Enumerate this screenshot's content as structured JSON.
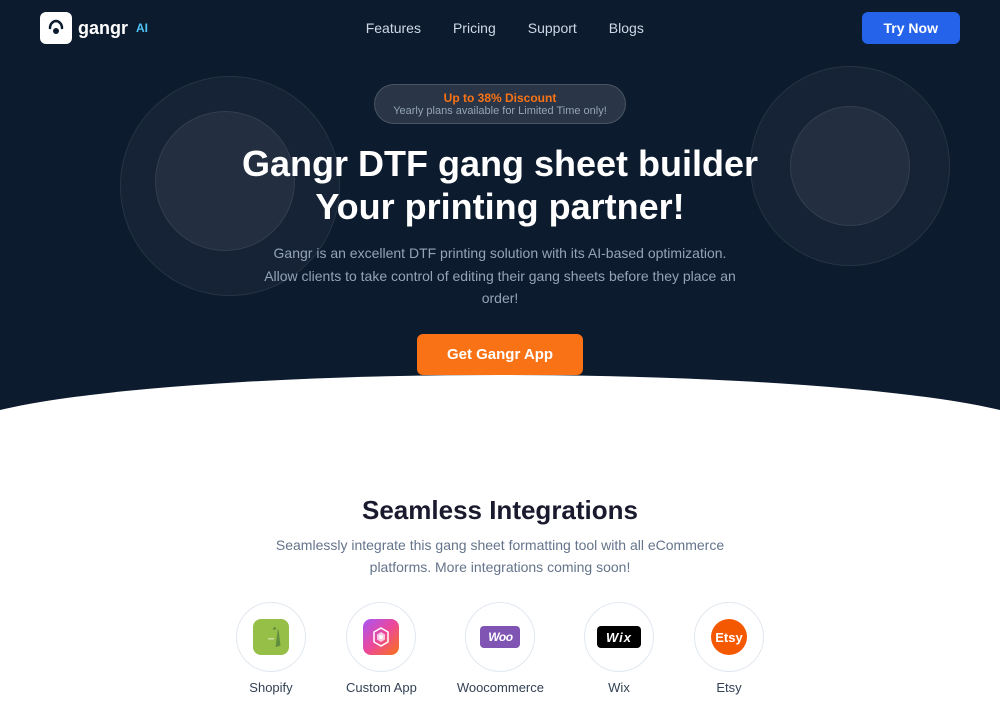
{
  "navbar": {
    "logo_icon_text": "G",
    "logo_text": "gangr",
    "logo_ai": "AI",
    "links": [
      {
        "label": "Features",
        "href": "#"
      },
      {
        "label": "Pricing",
        "href": "#"
      },
      {
        "label": "Support",
        "href": "#"
      },
      {
        "label": "Blogs",
        "href": "#"
      }
    ],
    "try_now_label": "Try Now"
  },
  "hero": {
    "discount_top": "Up to 38% Discount",
    "discount_sub": "Yearly plans available for Limited Time only!",
    "title_line1": "Gangr DTF gang sheet builder",
    "title_line2": "Your printing partner!",
    "description": "Gangr is an excellent DTF printing solution with its AI-based optimization. Allow clients to take control of editing their gang sheets before they place an order!",
    "cta_label": "Get Gangr App"
  },
  "integrations": {
    "title": "Seamless Integrations",
    "description": "Seamlessly integrate this gang sheet formatting tool with all eCommerce platforms. More integrations coming soon!",
    "items": [
      {
        "id": "shopify",
        "label": "Shopify",
        "icon_text": "S"
      },
      {
        "id": "customapp",
        "label": "Custom App",
        "icon_text": "✦"
      },
      {
        "id": "woocommerce",
        "label": "Woocommerce",
        "icon_text": "woo"
      },
      {
        "id": "wix",
        "label": "Wix",
        "icon_text": "Wix"
      },
      {
        "id": "etsy",
        "label": "Etsy",
        "icon_text": "Etsy"
      }
    ]
  }
}
